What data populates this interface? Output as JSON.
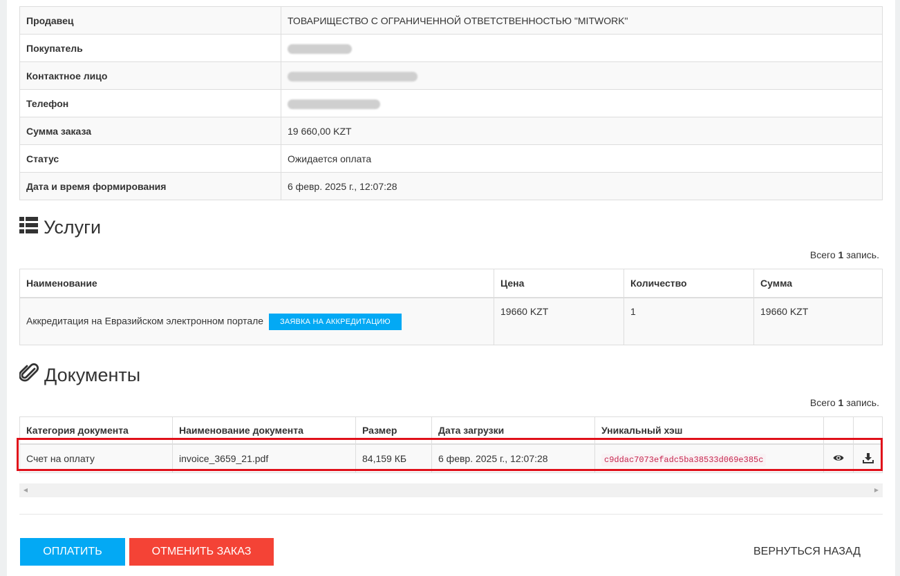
{
  "details": [
    {
      "label": "Продавец",
      "value": "ТОВАРИЩЕСТВО С ОГРАНИЧЕННОЙ ОТВЕТСТВЕННОСТЬЮ \"MITWORK\""
    },
    {
      "label": "Покупатель",
      "value": ""
    },
    {
      "label": "Контактное лицо",
      "value": ""
    },
    {
      "label": "Телефон",
      "value": ""
    },
    {
      "label": "Сумма заказа",
      "value": "19 660,00 KZT"
    },
    {
      "label": "Статус",
      "value": "Ожидается оплата"
    },
    {
      "label": "Дата и время формирования",
      "value": "6 февр. 2025 г., 12:07:28"
    }
  ],
  "services": {
    "title": "Услуги",
    "summary_prefix": "Всего",
    "summary_count": "1",
    "summary_suffix": "запись.",
    "columns": [
      "Наименование",
      "Цена",
      "Количество",
      "Сумма"
    ],
    "row": {
      "name": "Аккредитация на Евразийском электронном портале",
      "button": "ЗАЯВКА НА АККРЕДИТАЦИЮ",
      "price": "19660 KZT",
      "quantity": "1",
      "total": "19660 KZT"
    }
  },
  "documents": {
    "title": "Документы",
    "summary_prefix": "Всего",
    "summary_count": "1",
    "summary_suffix": "запись.",
    "columns": [
      "Категория документа",
      "Наименование документа",
      "Размер",
      "Дата загрузки",
      "Уникальный хэш",
      "",
      ""
    ],
    "row": {
      "category": "Счет на оплату",
      "name": "invoice_3659_21.pdf",
      "size": "84,159 КБ",
      "date": "6 февр. 2025 г., 12:07:28",
      "hash": "c9ddac7073efadc5ba38533d069e385c",
      "view_icon": "eye-icon",
      "download_icon": "download-icon"
    }
  },
  "actions": {
    "pay": "ОПЛАТИТЬ",
    "cancel": "ОТМЕНИТЬ ЗАКАЗ",
    "back": "ВЕРНУТЬСЯ НАЗАД"
  },
  "colors": {
    "primary": "#03a9f4",
    "danger": "#f44336",
    "highlight": "#e0101a"
  }
}
